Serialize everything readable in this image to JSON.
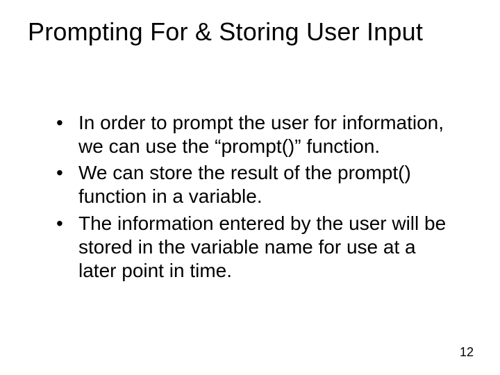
{
  "slide": {
    "title": "Prompting For & Storing User Input",
    "bullets": [
      "In order to prompt the user for information, we can use the “prompt()” function.",
      "We can store the result of the prompt() function in a variable.",
      "The information entered by the user will be stored in the variable name for use at a later point in time."
    ],
    "page_number": "12"
  }
}
